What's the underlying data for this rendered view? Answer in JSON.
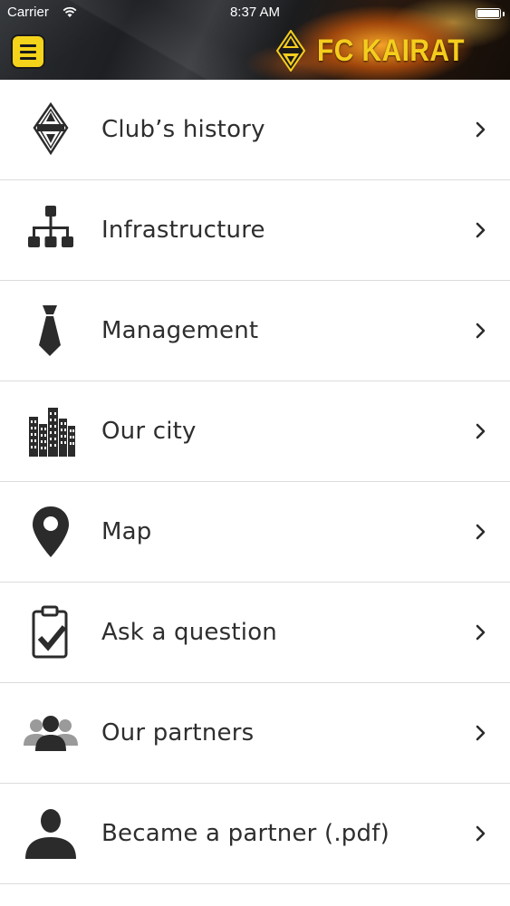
{
  "status_bar": {
    "carrier": "Carrier",
    "time": "8:37 AM",
    "battery_level": 1.0
  },
  "header": {
    "brand_name": "FC KAIRAT",
    "accent_color": "#f4d31b",
    "menu_icon": "hamburger-menu-icon",
    "logo_icon": "fc-kairat-crest-icon"
  },
  "menu": {
    "items": [
      {
        "label": "Club’s history",
        "icon": "club-crest-icon"
      },
      {
        "label": "Infrastructure",
        "icon": "org-chart-icon"
      },
      {
        "label": "Management",
        "icon": "necktie-icon"
      },
      {
        "label": "Our city",
        "icon": "city-buildings-icon"
      },
      {
        "label": "Map",
        "icon": "map-pin-icon"
      },
      {
        "label": "Ask a question",
        "icon": "clipboard-check-icon"
      },
      {
        "label": "Our partners",
        "icon": "group-people-icon"
      },
      {
        "label": "Became a partner (.pdf)",
        "icon": "person-icon"
      }
    ]
  }
}
